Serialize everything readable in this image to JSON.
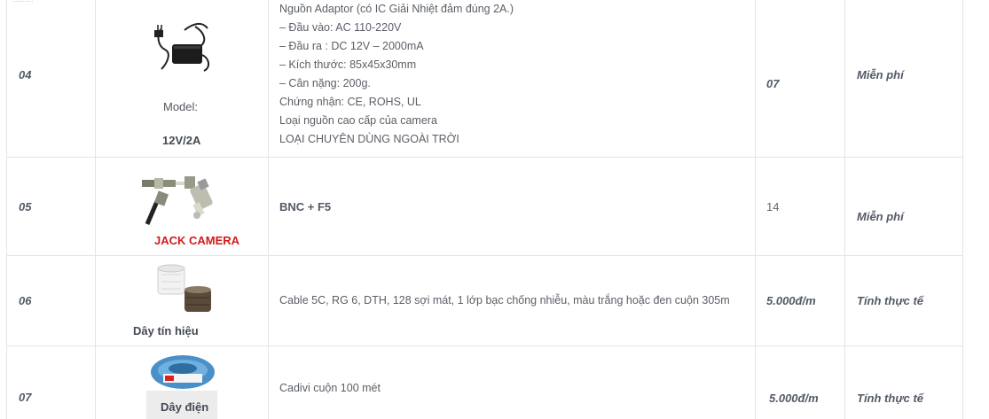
{
  "top_fragment": "............",
  "rows": [
    {
      "no": "04",
      "caption_model": "Model:",
      "caption_value": "12V/2A",
      "icon": "power-adapter-icon",
      "description_lines": [
        "Nguồn Adaptor  (có IC Giải Nhiệt đảm đúng 2A.)",
        "– Đầu vào: AC 110-220V",
        "– Đầu ra : DC 12V – 2000mA",
        "– Kích thước: 85x45x30mm",
        "– Cân nặng: 200g.",
        "Chứng nhận: CE, ROHS, UL",
        "Loại nguồn cao cấp của camera",
        "LOẠI CHUYÊN DÙNG NGOÀI TRỜI"
      ],
      "quantity": "07",
      "price": "Miễn phí"
    },
    {
      "no": "05",
      "caption": "JACK CAMERA",
      "icon": "bnc-connector-icon",
      "description": "BNC + F5",
      "quantity": "14",
      "price": "Miễn phí"
    },
    {
      "no": "06",
      "caption": "Dây tín hiệu",
      "icon": "cable-roll-icon",
      "description": "Cable 5C, RG 6, DTH, 128 sợi mát, 1 lớp bạc chống nhiễu, màu trắng hoặc đen cuộn 305m",
      "quantity": "5.000đ/m",
      "price": "Tính thực tế"
    },
    {
      "no": "07",
      "caption": "Dây điện",
      "icon": "electric-wire-roll-icon",
      "description": "Cadivi cuộn 100 mét",
      "quantity": "5.000đ/m",
      "price": "Tính thực tế"
    }
  ],
  "colors": {
    "accent_red": "#d21b1b",
    "border": "#e4e4e4",
    "text": "#555a60"
  }
}
